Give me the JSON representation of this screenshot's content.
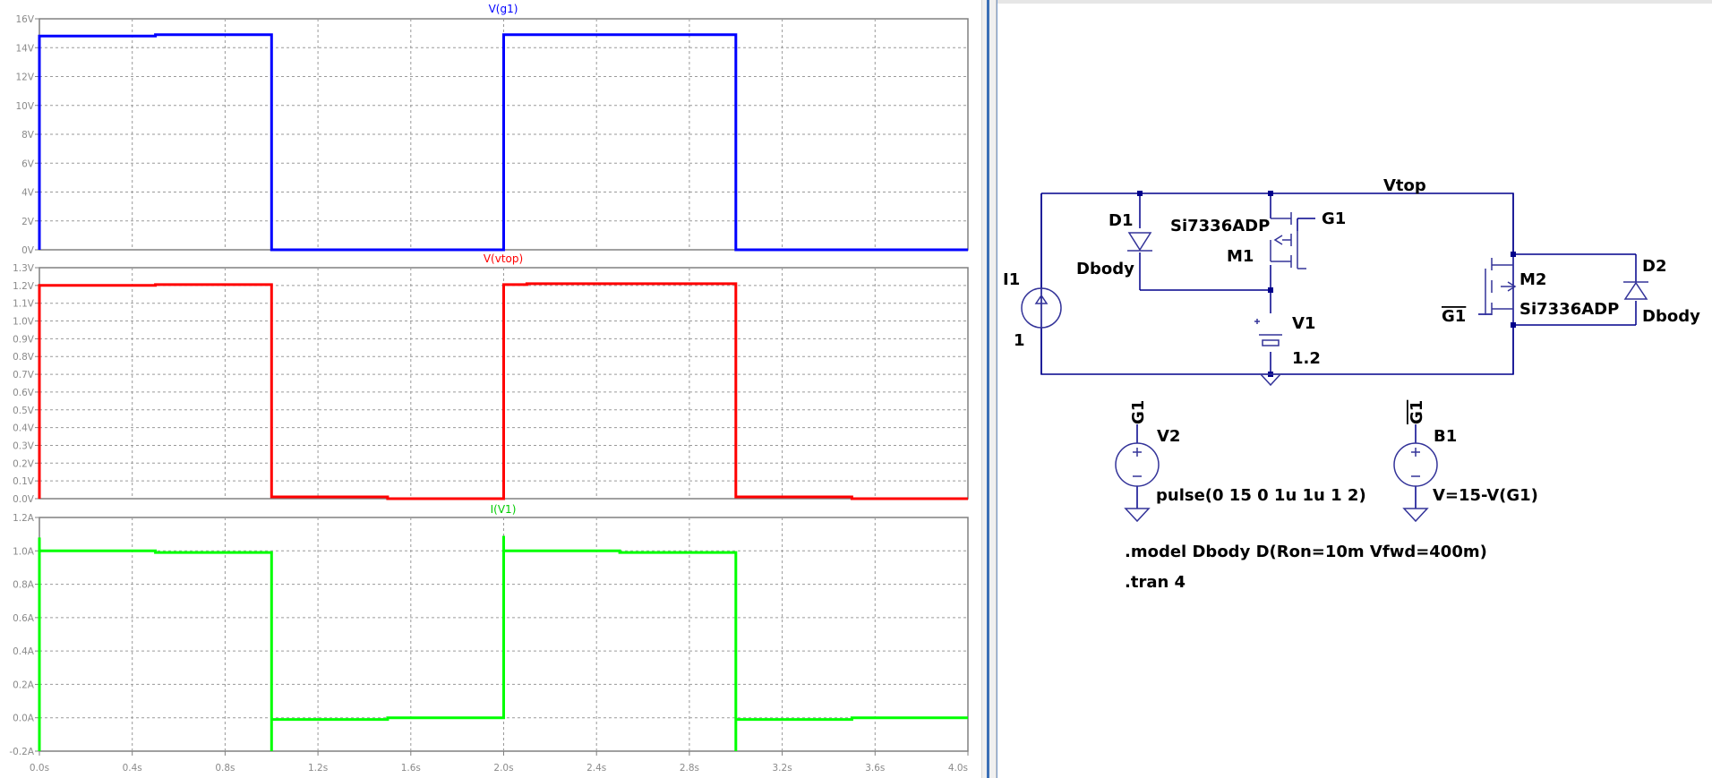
{
  "waveform_viewer": {
    "x_axis": {
      "ticks": [
        "0.0s",
        "0.4s",
        "0.8s",
        "1.2s",
        "1.6s",
        "2.0s",
        "2.4s",
        "2.8s",
        "3.2s",
        "3.6s",
        "4.0s"
      ],
      "range": [
        0,
        4
      ]
    },
    "plots": [
      {
        "id": "plot-vg1",
        "title": "V(g1)",
        "color": "#0000ff",
        "y_ticks": [
          "16V",
          "14V",
          "12V",
          "10V",
          "8V",
          "6V",
          "4V",
          "2V",
          "0V"
        ],
        "y_range": [
          0,
          16
        ]
      },
      {
        "id": "plot-vtop",
        "title": "V(vtop)",
        "color": "#ff0000",
        "y_ticks": [
          "1.3V",
          "1.2V",
          "1.1V",
          "1.0V",
          "0.9V",
          "0.8V",
          "0.7V",
          "0.6V",
          "0.5V",
          "0.4V",
          "0.3V",
          "0.2V",
          "0.1V",
          "0.0V"
        ],
        "y_range": [
          0,
          1.3
        ]
      },
      {
        "id": "plot-iv1",
        "title": "I(V1)",
        "color": "#00ff00",
        "y_ticks": [
          "1.2A",
          "1.0A",
          "0.8A",
          "0.6A",
          "0.4A",
          "0.2A",
          "0.0A",
          "-0.2A"
        ],
        "y_range": [
          -0.2,
          1.2
        ]
      }
    ]
  },
  "chart_data": [
    {
      "type": "line",
      "title": "V(g1)",
      "ylim": [
        0,
        16
      ],
      "xlim": [
        0,
        4
      ],
      "series": [
        {
          "name": "V(g1)",
          "color": "#0000ff",
          "x": [
            0,
            0,
            0.5,
            0.5,
            1.0,
            1.0,
            2.0,
            2.0,
            2.5,
            2.5,
            3.0,
            3.0,
            4.0
          ],
          "y": [
            0,
            14.8,
            14.8,
            14.9,
            14.9,
            0,
            0,
            14.9,
            14.9,
            14.9,
            14.9,
            0,
            0
          ]
        }
      ]
    },
    {
      "type": "line",
      "title": "V(vtop)",
      "ylim": [
        0,
        1.3
      ],
      "xlim": [
        0,
        4
      ],
      "series": [
        {
          "name": "V(vtop)",
          "color": "#ff0000",
          "x": [
            0,
            0,
            0.5,
            0.5,
            1.0,
            1.0,
            1.5,
            1.5,
            2.0,
            2.0,
            2.1,
            2.1,
            3.0,
            3.0,
            3.5,
            3.5,
            4.0
          ],
          "y": [
            0,
            1.2,
            1.2,
            1.205,
            1.205,
            0.01,
            0.01,
            0.0,
            0.0,
            1.205,
            1.205,
            1.21,
            1.21,
            0.01,
            0.01,
            0.0,
            0.0
          ]
        }
      ]
    },
    {
      "type": "line",
      "title": "I(V1)",
      "ylim": [
        -0.2,
        1.2
      ],
      "xlim": [
        0,
        4
      ],
      "series": [
        {
          "name": "I(V1)",
          "color": "#00ff00",
          "x": [
            0,
            0,
            0,
            0.5,
            0.5,
            1.0,
            1.0,
            1.0,
            1.5,
            1.5,
            2.0,
            2.0,
            2.0,
            2.0,
            2.5,
            2.5,
            3.0,
            3.0,
            3.0,
            3.5,
            3.5,
            4.0
          ],
          "y": [
            -0.2,
            1.08,
            1.0,
            1.0,
            0.99,
            0.99,
            -0.2,
            -0.01,
            -0.01,
            0.0,
            0.0,
            1.09,
            1.0,
            1.0,
            1.0,
            0.99,
            0.99,
            -0.2,
            -0.01,
            -0.01,
            0.0,
            0.0
          ]
        }
      ]
    }
  ],
  "schematic": {
    "net_vtop": "Vtop",
    "d1_ref": "D1",
    "d1_model": "Dbody",
    "m1_part": "Si7336ADP",
    "m1_ref": "M1",
    "m1_gate": "G1",
    "i1_ref": "I1",
    "i1_value": "1",
    "v1_ref": "V1",
    "v1_value": "1.2",
    "m2_ref": "M2",
    "m2_part": "Si7336ADP",
    "m2_gate": "G1",
    "d2_ref": "D2",
    "d2_model": "Dbody",
    "v2_net": "G1",
    "v2_ref": "V2",
    "v2_value": "pulse(0 15 0 1u 1u 1 2)",
    "b1_net": "G1",
    "b1_ref": "B1",
    "b1_value": "V=15-V(G1)",
    "directive_model": ".model Dbody D(Ron=10m Vfwd=400m)",
    "directive_tran": ".tran 4",
    "wire_color": "#00008b",
    "component_color": "#333399"
  }
}
